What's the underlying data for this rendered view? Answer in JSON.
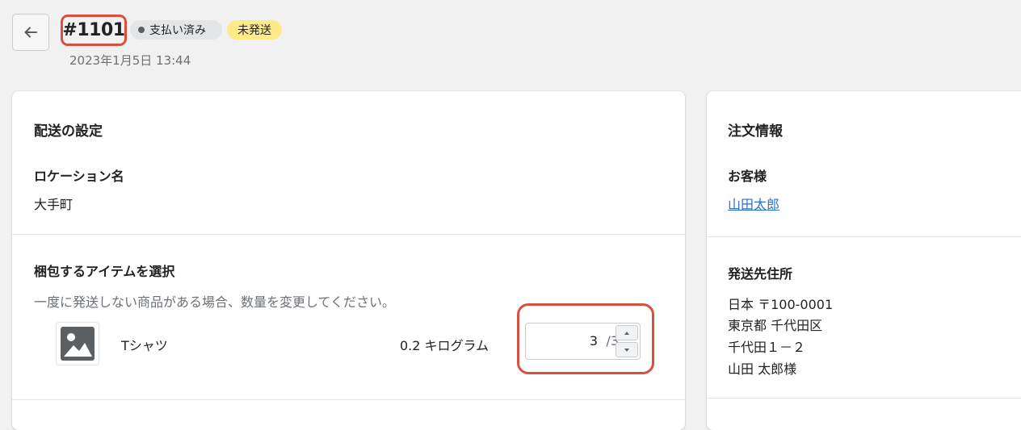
{
  "header": {
    "order_number": "#1101",
    "payment_badge": "支払い済み",
    "fulfillment_badge": "未発送",
    "date": "2023年1月5日 13:44"
  },
  "shipping": {
    "title": "配送の設定",
    "location_heading": "ロケーション名",
    "location_value": "大手町",
    "items_heading": "梱包するアイテムを選択",
    "items_help": "一度に発送しない商品がある場合、数量を変更してください。",
    "item": {
      "name": "Tシャツ",
      "weight": "0.2 キログラム",
      "quantity": "3",
      "quantity_max": "/3"
    }
  },
  "order_info": {
    "title": "注文情報",
    "customer_heading": "お客様",
    "customer_name": "山田太郎",
    "address_heading": "発送先住所",
    "address_lines": [
      "日本 〒100-0001",
      "東京都 千代田区",
      "千代田１－２",
      "山田 太郎様"
    ]
  },
  "colors": {
    "highlight": "#d9503f",
    "link": "#2c6ecb",
    "unfulfilled_badge": "#ffea8a"
  },
  "icons": {
    "back": "arrow-left-icon",
    "thumbnail": "image-placeholder-icon"
  }
}
